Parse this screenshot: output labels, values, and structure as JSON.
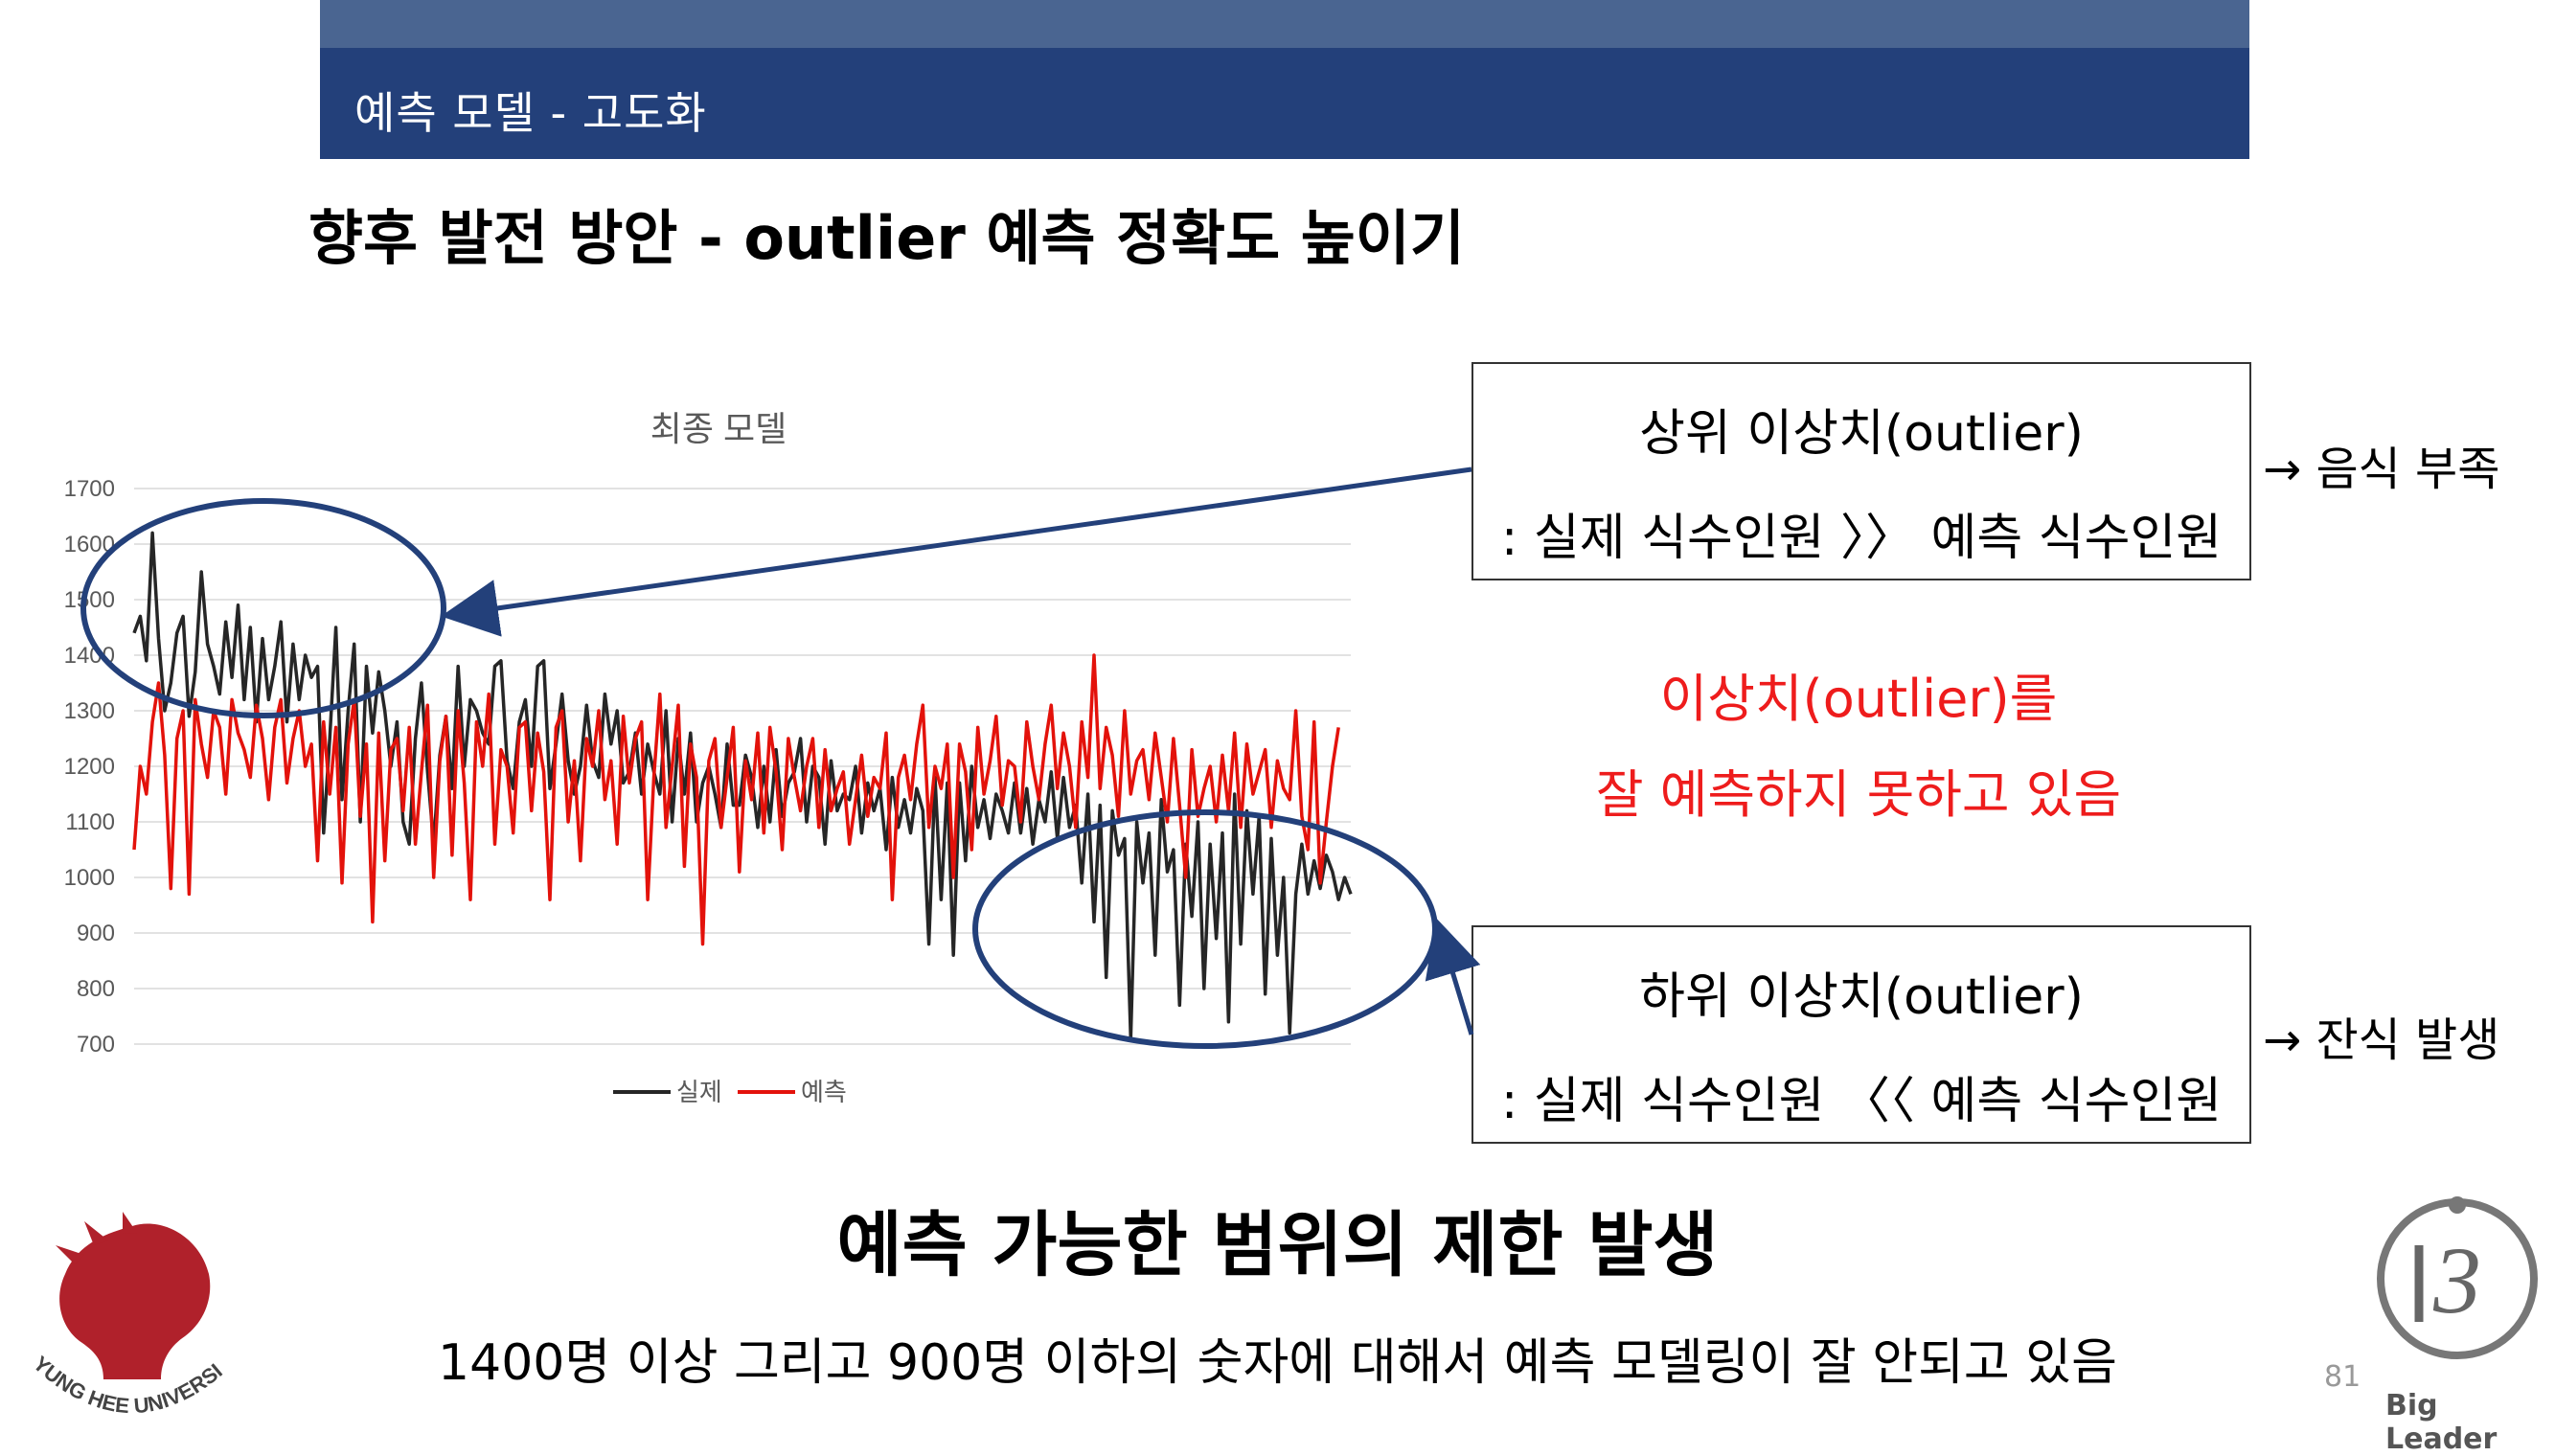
{
  "header": {
    "title": "예측 모델 - 고도화"
  },
  "subtitle": "향후 발전 방안 - outlier 예측 정확도 높이기",
  "chart_data": {
    "type": "line",
    "title": "최종 모델",
    "ylim": [
      700,
      1700
    ],
    "yticks": [
      1700,
      1600,
      1500,
      1400,
      1300,
      1200,
      1100,
      1000,
      900,
      800,
      700
    ],
    "grid": true,
    "legend": "bottom",
    "x": [
      1,
      2,
      3,
      4,
      5,
      6,
      7,
      8,
      9,
      10,
      11,
      12,
      13,
      14,
      15,
      16,
      17,
      18,
      19,
      20,
      21,
      22,
      23,
      24,
      25,
      26,
      27,
      28,
      29,
      30,
      31,
      32,
      33,
      34,
      35,
      36,
      37,
      38,
      39,
      40,
      41,
      42,
      43,
      44,
      45,
      46,
      47,
      48,
      49,
      50,
      51,
      52,
      53,
      54,
      55,
      56,
      57,
      58,
      59,
      60,
      61,
      62,
      63,
      64,
      65,
      66,
      67,
      68,
      69,
      70,
      71,
      72,
      73,
      74,
      75,
      76,
      77,
      78,
      79,
      80,
      81,
      82,
      83,
      84,
      85,
      86,
      87,
      88,
      89,
      90,
      91,
      92,
      93,
      94,
      95,
      96,
      97,
      98,
      99,
      100,
      101,
      102,
      103,
      104,
      105,
      106,
      107,
      108,
      109,
      110,
      111,
      112,
      113,
      114,
      115,
      116,
      117,
      118,
      119,
      120,
      121,
      122,
      123,
      124,
      125,
      126,
      127,
      128,
      129,
      130,
      131,
      132,
      133,
      134,
      135,
      136,
      137,
      138,
      139,
      140,
      141,
      142,
      143,
      144,
      145,
      146,
      147,
      148,
      149,
      150,
      151,
      152,
      153,
      154,
      155,
      156,
      157,
      158,
      159,
      160,
      161,
      162,
      163,
      164,
      165,
      166,
      167,
      168,
      169,
      170,
      171,
      172,
      173,
      174,
      175,
      176,
      177,
      178,
      179,
      180,
      181,
      182,
      183,
      184,
      185,
      186,
      187,
      188,
      189,
      190,
      191,
      192,
      193,
      194,
      195,
      196,
      197,
      198,
      199,
      200
    ],
    "series": [
      {
        "name": "실제",
        "color": "#262626",
        "values": [
          1440,
          1470,
          1390,
          1620,
          1430,
          1300,
          1350,
          1440,
          1470,
          1290,
          1370,
          1550,
          1420,
          1380,
          1330,
          1460,
          1360,
          1490,
          1320,
          1450,
          1280,
          1430,
          1320,
          1380,
          1460,
          1280,
          1420,
          1320,
          1400,
          1360,
          1380,
          1080,
          1250,
          1450,
          1140,
          1300,
          1420,
          1100,
          1380,
          1260,
          1370,
          1300,
          1200,
          1280,
          1100,
          1060,
          1250,
          1350,
          1190,
          1060,
          1220,
          1290,
          1160,
          1380,
          1200,
          1320,
          1300,
          1260,
          1240,
          1380,
          1390,
          1210,
          1160,
          1280,
          1320,
          1200,
          1380,
          1390,
          1160,
          1240,
          1330,
          1210,
          1150,
          1200,
          1310,
          1210,
          1180,
          1330,
          1240,
          1300,
          1170,
          1190,
          1260,
          1150,
          1240,
          1190,
          1150,
          1300,
          1100,
          1250,
          1150,
          1260,
          1100,
          1170,
          1200,
          1150,
          1090,
          1240,
          1130,
          1130,
          1220,
          1180,
          1090,
          1200,
          1100,
          1230,
          1110,
          1170,
          1190,
          1250,
          1100,
          1200,
          1180,
          1060,
          1210,
          1120,
          1150,
          1140,
          1200,
          1080,
          1170,
          1120,
          1160,
          1050,
          1180,
          1090,
          1140,
          1080,
          1160,
          1120,
          880,
          1180,
          960,
          1170,
          860,
          1170,
          1030,
          1200,
          1090,
          1140,
          1070,
          1150,
          1120,
          1080,
          1170,
          1080,
          1160,
          1060,
          1140,
          1100,
          1190,
          1070,
          1180,
          1090,
          1130,
          990,
          1150,
          920,
          1130,
          820,
          1120,
          1040,
          1070,
          710,
          1100,
          990,
          1080,
          860,
          1140,
          1010,
          1050,
          770,
          1060,
          930,
          1100,
          800,
          1060,
          890,
          1080,
          740,
          1150,
          880,
          1120,
          970,
          1110,
          790,
          1070,
          860,
          1000,
          720,
          970,
          1060,
          970,
          1030,
          980,
          1040,
          1010,
          960,
          1000,
          970
        ]
      },
      {
        "name": "예측",
        "color": "#e3120b",
        "values": [
          1050,
          1200,
          1150,
          1280,
          1350,
          1220,
          980,
          1250,
          1300,
          970,
          1320,
          1240,
          1180,
          1300,
          1270,
          1150,
          1320,
          1260,
          1230,
          1180,
          1310,
          1250,
          1140,
          1270,
          1320,
          1170,
          1250,
          1300,
          1200,
          1240,
          1030,
          1280,
          1150,
          1270,
          990,
          1240,
          1320,
          1110,
          1240,
          920,
          1260,
          1030,
          1230,
          1250,
          1120,
          1270,
          1060,
          1190,
          1310,
          1000,
          1210,
          1290,
          1040,
          1300,
          1170,
          960,
          1280,
          1200,
          1330,
          1060,
          1230,
          1200,
          1080,
          1270,
          1280,
          1120,
          1260,
          1190,
          960,
          1270,
          1300,
          1100,
          1210,
          1030,
          1250,
          1200,
          1300,
          1140,
          1210,
          1060,
          1290,
          1170,
          1250,
          1280,
          960,
          1180,
          1330,
          1090,
          1200,
          1310,
          1020,
          1240,
          1180,
          880,
          1210,
          1250,
          1090,
          1180,
          1270,
          1010,
          1210,
          1140,
          1260,
          1080,
          1270,
          1190,
          1050,
          1250,
          1180,
          1120,
          1200,
          1250,
          1090,
          1230,
          1120,
          1160,
          1190,
          1060,
          1140,
          1220,
          1110,
          1180,
          1160,
          1260,
          960,
          1180,
          1220,
          1140,
          1240,
          1310,
          1090,
          1200,
          1160,
          1240,
          1000,
          1240,
          1190,
          1050,
          1270,
          1150,
          1210,
          1290,
          1130,
          1210,
          1200,
          1100,
          1280,
          1200,
          1140,
          1240,
          1310,
          1160,
          1260,
          1200,
          1090,
          1280,
          1180,
          1400,
          1160,
          1270,
          1220,
          1110,
          1300,
          1150,
          1210,
          1230,
          1140,
          1260,
          1180,
          1100,
          1250,
          1130,
          1000,
          1230,
          1110,
          1160,
          1200,
          1100,
          1220,
          1120,
          1260,
          1090,
          1240,
          1150,
          1190,
          1230,
          1090,
          1210,
          1160,
          1140,
          1300,
          1110,
          1050,
          1280,
          990,
          1100,
          1200,
          1270
        ]
      }
    ]
  },
  "annotations": {
    "upper_box": {
      "line1": "상위 이상치(outlier)",
      "line2": ": 실제 식수인원 〉〉 예측 식수인원"
    },
    "upper_note": "→ 음식 부족",
    "lower_box": {
      "line1": "하위 이상치(outlier)",
      "line2": ": 실제 식수인원 〈〈 예측 식수인원"
    },
    "lower_note": "→ 잔식 발생",
    "red_line1": "이상치(outlier)를",
    "red_line2": "잘 예측하지 못하고 있음"
  },
  "conclusion": "예측 가능한 범위의 제한 발생",
  "detail": "1400명 이상 그리고 900명 이하의 숫자에 대해서 예측 모델링이 잘 안되고 있음",
  "page_number": "81",
  "logo_left_text": "KYUNG HEE UNIVERSITY",
  "logo_right_text": "Big Leader",
  "colors": {
    "header": "#23407a",
    "header_strip": "#4a6591",
    "red_text": "#ee1c1c",
    "ellipse": "#23407a"
  }
}
